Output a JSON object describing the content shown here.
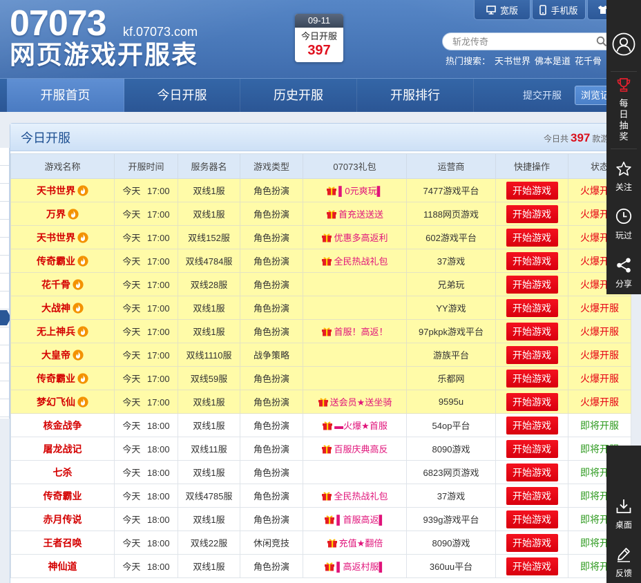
{
  "header": {
    "logo_number": "07073",
    "logo_domain": "kf.07073.com",
    "logo_title": "网页游戏开服表",
    "date_box": {
      "date": "09-11",
      "label": "今日开服",
      "count": "397"
    },
    "top_links": [
      {
        "icon": "monitor-icon",
        "label": "宽版"
      },
      {
        "icon": "phone-icon",
        "label": "手机版"
      },
      {
        "icon": "shirt-icon"
      }
    ],
    "search": {
      "placeholder": "斩龙传奇",
      "icon": "search-icon"
    },
    "hot_search": {
      "label": "热门搜索：",
      "items": [
        "天书世界",
        "佛本是道",
        "花千骨"
      ]
    }
  },
  "nav": {
    "tabs": [
      "开服首页",
      "今日开服",
      "历史开服",
      "开服排行"
    ],
    "active_index": 0,
    "submit_label": "提交开服",
    "history_label": "浏览记"
  },
  "panel": {
    "title": "今日开服",
    "summary_prefix": "今日共",
    "summary_count": "397",
    "summary_suffix": "款游"
  },
  "table": {
    "columns": [
      "游戏名称",
      "开服时间",
      "服务器名",
      "游戏类型",
      "07073礼包",
      "运营商",
      "快捷操作",
      "状态"
    ],
    "rows": [
      {
        "name": "天书世界",
        "hot": true,
        "time": "今天 17:00",
        "server": "双线1服",
        "type": "角色扮演",
        "gift": "▌0元爽玩▌",
        "operator": "7477游戏平台",
        "action": "开始游戏",
        "status": "火爆开服"
      },
      {
        "name": "万界",
        "hot": true,
        "time": "今天 17:00",
        "server": "双线1服",
        "type": "角色扮演",
        "gift": "首充送送送",
        "operator": "1188网页游戏",
        "action": "开始游戏",
        "status": "火爆开服"
      },
      {
        "name": "天书世界",
        "hot": true,
        "time": "今天 17:00",
        "server": "双线152服",
        "type": "角色扮演",
        "gift": "优惠多高返利",
        "operator": "602游戏平台",
        "action": "开始游戏",
        "status": "火爆开服"
      },
      {
        "name": "传奇霸业",
        "hot": true,
        "time": "今天 17:00",
        "server": "双线4784服",
        "type": "角色扮演",
        "gift": "全民热战礼包",
        "operator": "37游戏",
        "action": "开始游戏",
        "status": "火爆开服"
      },
      {
        "name": "花千骨",
        "hot": true,
        "time": "今天 17:00",
        "server": "双线28服",
        "type": "角色扮演",
        "gift": "",
        "operator": "兄弟玩",
        "action": "开始游戏",
        "status": "火爆开服"
      },
      {
        "name": "大战神",
        "hot": true,
        "time": "今天 17:00",
        "server": "双线1服",
        "type": "角色扮演",
        "gift": "",
        "operator": "YY游戏",
        "action": "开始游戏",
        "status": "火爆开服"
      },
      {
        "name": "无上神兵",
        "hot": true,
        "time": "今天 17:00",
        "server": "双线1服",
        "type": "角色扮演",
        "gift": "首服！高返！",
        "operator": "97pkpk游戏平台",
        "action": "开始游戏",
        "status": "火爆开服"
      },
      {
        "name": "大皇帝",
        "hot": true,
        "time": "今天 17:00",
        "server": "双线1110服",
        "type": "战争策略",
        "gift": "",
        "operator": "游族平台",
        "action": "开始游戏",
        "status": "火爆开服"
      },
      {
        "name": "传奇霸业",
        "hot": true,
        "time": "今天 17:00",
        "server": "双线59服",
        "type": "角色扮演",
        "gift": "",
        "operator": "乐都网",
        "action": "开始游戏",
        "status": "火爆开服"
      },
      {
        "name": "梦幻飞仙",
        "hot": true,
        "time": "今天 17:00",
        "server": "双线1服",
        "type": "角色扮演",
        "gift": "送会员★送坐骑",
        "operator": "9595u",
        "action": "开始游戏",
        "status": "火爆开服"
      },
      {
        "name": "核金战争",
        "hot": false,
        "time": "今天 18:00",
        "server": "双线1服",
        "type": "角色扮演",
        "gift": "▬火爆★首服",
        "operator": "54op平台",
        "action": "开始游戏",
        "status": "即将开服"
      },
      {
        "name": "屠龙战记",
        "hot": false,
        "time": "今天 18:00",
        "server": "双线11服",
        "type": "角色扮演",
        "gift": "百服庆典高反",
        "operator": "8090游戏",
        "action": "开始游戏",
        "status": "即将开服"
      },
      {
        "name": "七杀",
        "hot": false,
        "time": "今天 18:00",
        "server": "双线1服",
        "type": "角色扮演",
        "gift": "",
        "operator": "6823网页游戏",
        "action": "开始游戏",
        "status": "即将开服"
      },
      {
        "name": "传奇霸业",
        "hot": false,
        "time": "今天 18:00",
        "server": "双线4785服",
        "type": "角色扮演",
        "gift": "全民热战礼包",
        "operator": "37游戏",
        "action": "开始游戏",
        "status": "即将开服"
      },
      {
        "name": "赤月传说",
        "hot": false,
        "time": "今天 18:00",
        "server": "双线1服",
        "type": "角色扮演",
        "gift": "▌首服高返▌",
        "operator": "939g游戏平台",
        "action": "开始游戏",
        "status": "即将开服"
      },
      {
        "name": "王者召唤",
        "hot": false,
        "time": "今天 18:00",
        "server": "双线22服",
        "type": "休闲竞技",
        "gift": "充值★翻倍",
        "operator": "8090游戏",
        "action": "开始游戏",
        "status": "即将开服"
      },
      {
        "name": "神仙道",
        "hot": false,
        "time": "今天 18:00",
        "server": "双线1服",
        "type": "角色扮演",
        "gift": "▌高返村服▌",
        "operator": "360uu平台",
        "action": "开始游戏",
        "status": "即将开服"
      }
    ]
  },
  "sidebar": {
    "top": [
      {
        "icon": "user-icon"
      },
      {
        "icon": "trophy-icon",
        "label": "每日抽奖"
      },
      {
        "icon": "star-icon",
        "label": "关注"
      },
      {
        "icon": "clock-icon",
        "label": "玩过"
      },
      {
        "icon": "share-icon",
        "label": "分享"
      }
    ],
    "bottom": [
      {
        "icon": "download-icon",
        "label": "桌面"
      },
      {
        "icon": "pencil-icon",
        "label": "反馈"
      }
    ]
  },
  "colors": {
    "header_blue": "#4877b8",
    "nav_blue": "#2b5695",
    "hot_row": "#fffba8",
    "play_button": "#e8001c",
    "hot_status": "#e60012",
    "soon_status": "#2e9a1f",
    "gift_text": "#e0137a",
    "sidebar": "#262626"
  }
}
